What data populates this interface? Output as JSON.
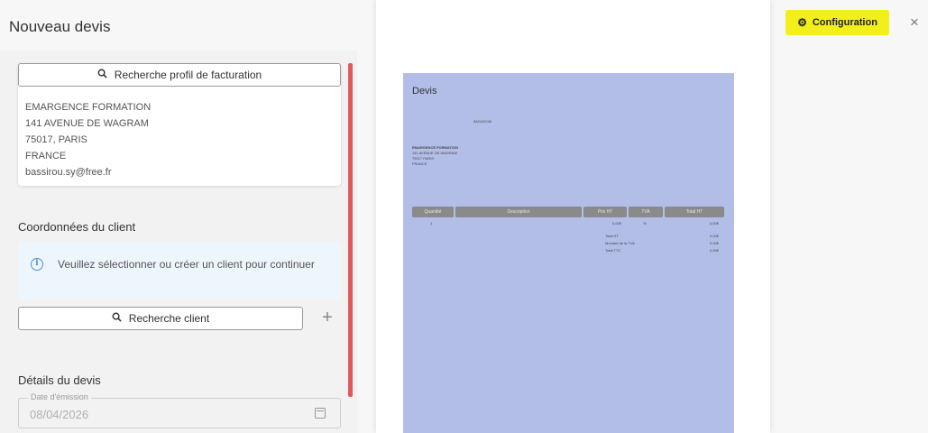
{
  "header": {
    "title": "Nouveau devis",
    "config_label": "Configuration",
    "close_symbol": "×",
    "config_color": "#f2ef1a"
  },
  "billing": {
    "search_label": "Recherche profil de facturation",
    "address_lines": [
      "EMARGENCE FORMATION",
      "141 AVENUE DE WAGRAM",
      "75017, PARIS",
      "FRANCE",
      "bassirou.sy@free.fr"
    ]
  },
  "client": {
    "section_title": "Coordonnées du client",
    "info_message": "Veuillez sélectionner ou créer un client pour continuer",
    "search_label": "Recherche client",
    "add_symbol": "+"
  },
  "details": {
    "section_title": "Détails du devis",
    "issue_date_label": "Date d'émission",
    "issue_date_value": "08/04/2026"
  },
  "preview": {
    "title": "Devis",
    "date_value": "08/04/2026",
    "client_lines": [
      "EMARGENCE FORMATION",
      "141 AVENUE DE WAGRAM",
      "75017 PARIS",
      "FRANCE"
    ],
    "table_headers": [
      "Quantité",
      "Description",
      "Prix HT",
      "TVA",
      "Total HT"
    ],
    "row_values": [
      "1",
      "0,00€",
      "%",
      "0,00€"
    ],
    "totals": [
      {
        "label": "Total HT",
        "value": "0,00€"
      },
      {
        "label": "Montant de la TVA",
        "value": "0,00€"
      },
      {
        "label": "Total TTC",
        "value": "0,00€"
      }
    ],
    "sheet_color": "#b3bee8"
  },
  "icons": {
    "search": "search-icon",
    "info": "info-icon",
    "calendar": "calendar-icon",
    "gear": "gear-icon",
    "close": "close-icon"
  }
}
